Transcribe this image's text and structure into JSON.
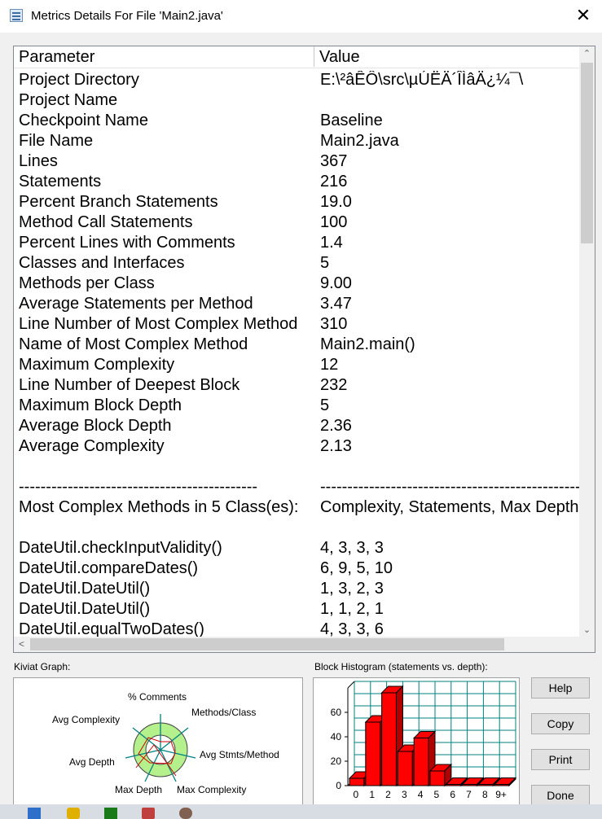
{
  "window": {
    "title": "Metrics Details For File 'Main2.java'",
    "close_glyph": "✕"
  },
  "table": {
    "columns": [
      "Parameter",
      "Value"
    ],
    "rows": [
      {
        "p": "Project Directory",
        "v": "E:\\²âÊÔ\\src\\µÚËÄ´ÎÌâÄ¿¼¯\\"
      },
      {
        "p": "Project Name",
        "v": ""
      },
      {
        "p": "Checkpoint Name",
        "v": "Baseline"
      },
      {
        "p": "File Name",
        "v": "Main2.java"
      },
      {
        "p": "Lines",
        "v": "367"
      },
      {
        "p": "Statements",
        "v": "216"
      },
      {
        "p": "Percent Branch Statements",
        "v": "19.0"
      },
      {
        "p": "Method Call Statements",
        "v": "100"
      },
      {
        "p": "Percent Lines with Comments",
        "v": "1.4"
      },
      {
        "p": "Classes and Interfaces",
        "v": "5"
      },
      {
        "p": "Methods per Class",
        "v": "9.00"
      },
      {
        "p": "Average Statements per Method",
        "v": "3.47"
      },
      {
        "p": "Line Number of Most Complex Method",
        "v": "310"
      },
      {
        "p": "Name of Most Complex Method",
        "v": "Main2.main()"
      },
      {
        "p": "Maximum Complexity",
        "v": "12"
      },
      {
        "p": "Line Number of Deepest Block",
        "v": "232"
      },
      {
        "p": "Maximum Block Depth",
        "v": "5"
      },
      {
        "p": "Average Block Depth",
        "v": "2.36"
      },
      {
        "p": "Average Complexity",
        "v": "2.13"
      },
      {
        "p": "",
        "v": ""
      },
      {
        "p": "--------------------------------------------",
        "v": "------------------------------------------------------"
      },
      {
        "p": "Most Complex Methods in 5 Class(es):",
        "v": "Complexity, Statements, Max Depth"
      },
      {
        "p": "",
        "v": ""
      },
      {
        "p": "DateUtil.checkInputValidity()",
        "v": "4, 3, 3, 3"
      },
      {
        "p": "DateUtil.compareDates()",
        "v": "6, 9, 5, 10"
      },
      {
        "p": "DateUtil.DateUtil()",
        "v": "1, 3, 2, 3"
      },
      {
        "p": "DateUtil.DateUtil()",
        "v": "1, 1, 2, 1"
      },
      {
        "p": "DateUtil.equalTwoDates()",
        "v": "4, 3, 3, 6"
      }
    ],
    "scroll_up": "⌃",
    "scroll_down": "⌄",
    "scroll_left": "<",
    "scroll_right": ">"
  },
  "kiviat": {
    "label": "Kiviat Graph:",
    "axes": [
      "% Comments",
      "Methods/Class",
      "Avg Stmts/Method",
      "Max Complexity",
      "Max Depth",
      "Avg Depth",
      "Avg Complexity"
    ]
  },
  "histogram": {
    "label": "Block Histogram (statements vs. depth):",
    "bar_color": "#ff0000",
    "grid_color": "#008080"
  },
  "buttons": {
    "help": "Help",
    "copy": "Copy",
    "print": "Print",
    "done": "Done"
  },
  "chart_data": {
    "type": "bar",
    "categories": [
      "0",
      "1",
      "2",
      "3",
      "4",
      "5",
      "6",
      "7",
      "8",
      "9+"
    ],
    "values": [
      6,
      52,
      76,
      28,
      39,
      12,
      1,
      1,
      1,
      1
    ],
    "y_ticks": [
      "0",
      "20",
      "40",
      "60"
    ],
    "ylim": [
      0,
      80
    ]
  }
}
